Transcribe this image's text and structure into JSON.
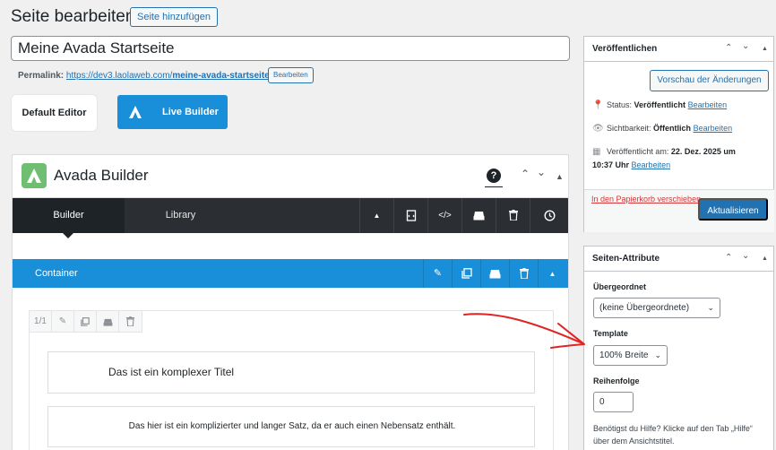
{
  "header": {
    "page_title": "Seite bearbeiten",
    "add_page_label": "Seite hinzufügen"
  },
  "post": {
    "title_value": "Meine Avada Startseite",
    "permalink_label": "Permalink:",
    "permalink_base": "https://dev3.laolaweb.com/",
    "permalink_slug": "meine-avada-startseite",
    "permalink_trail": "/",
    "permalink_edit_label": "Bearbeiten"
  },
  "editor_switch": {
    "default_label": "Default Editor",
    "live_label": "Live Builder"
  },
  "builder": {
    "title": "Avada Builder",
    "help_glyph": "?",
    "tabs": [
      {
        "label": "Builder",
        "active": true
      },
      {
        "label": "Library",
        "active": false
      }
    ],
    "toolbar_icons": [
      "collapse-icon",
      "page-template-icon",
      "code-icon",
      "save-icon",
      "trash-icon",
      "history-icon"
    ],
    "container_label": "Container",
    "column_size": "1/1",
    "elements": [
      {
        "text": "Das ist ein komplexer Titel"
      },
      {
        "text": "Das hier ist ein komplizierter und langer Satz, da er auch einen Nebensatz enthält."
      }
    ]
  },
  "publish_box": {
    "title": "Veröffentlichen",
    "preview_label": "Vorschau der Änderungen",
    "status_label": "Status:",
    "status_value": "Veröffentlicht",
    "status_edit": "Bearbeiten",
    "visibility_label": "Sichtbarkeit:",
    "visibility_value": "Öffentlich",
    "visibility_edit": "Bearbeiten",
    "published_label": "Veröffentlicht am:",
    "published_value_1": "22. Dez. 2025 um",
    "published_value_2": "10:37 Uhr",
    "published_edit": "Bearbeiten",
    "trash_label": "In den Papierkorb verschieben",
    "update_label": "Aktualisieren"
  },
  "attributes_box": {
    "title": "Seiten-Attribute",
    "parent_label": "Übergeordnet",
    "parent_value": "(keine Übergeordnete)",
    "template_label": "Template",
    "template_value": "100% Breite",
    "order_label": "Reihenfolge",
    "order_value": "0",
    "help_text": "Benötigst du Hilfe? Klicke auf den Tab „Hilfe“ über dem Ansichtstitel."
  },
  "colors": {
    "accent_blue": "#2271b1",
    "builder_blue": "#198fd9",
    "builder_dark": "#1d2327",
    "avada_green": "#6fbf73",
    "danger_red": "#d63638",
    "annotation_red": "#e02424"
  }
}
